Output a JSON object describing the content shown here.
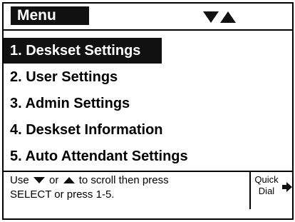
{
  "title": "Menu",
  "scroll_indicator": {
    "icons": [
      "triangle-down-icon",
      "triangle-up-icon"
    ]
  },
  "menu": {
    "items": [
      {
        "label": "1. Deskset Settings",
        "selected": true
      },
      {
        "label": "2. User Settings",
        "selected": false
      },
      {
        "label": "3. Admin Settings",
        "selected": false
      },
      {
        "label": "4. Deskset Information",
        "selected": false
      },
      {
        "label": "5. Auto Attendant Settings",
        "selected": false
      }
    ]
  },
  "footer": {
    "use": "Use",
    "or": "or",
    "scroll_text": "to scroll then press",
    "line2": "SELECT or press 1-5."
  },
  "softkey": {
    "line1": "Quick",
    "line2": "Dial",
    "icon": "arrow-right-icon"
  },
  "colors": {
    "highlight": "#111111",
    "background": "#ffffff",
    "text": "#000000"
  }
}
